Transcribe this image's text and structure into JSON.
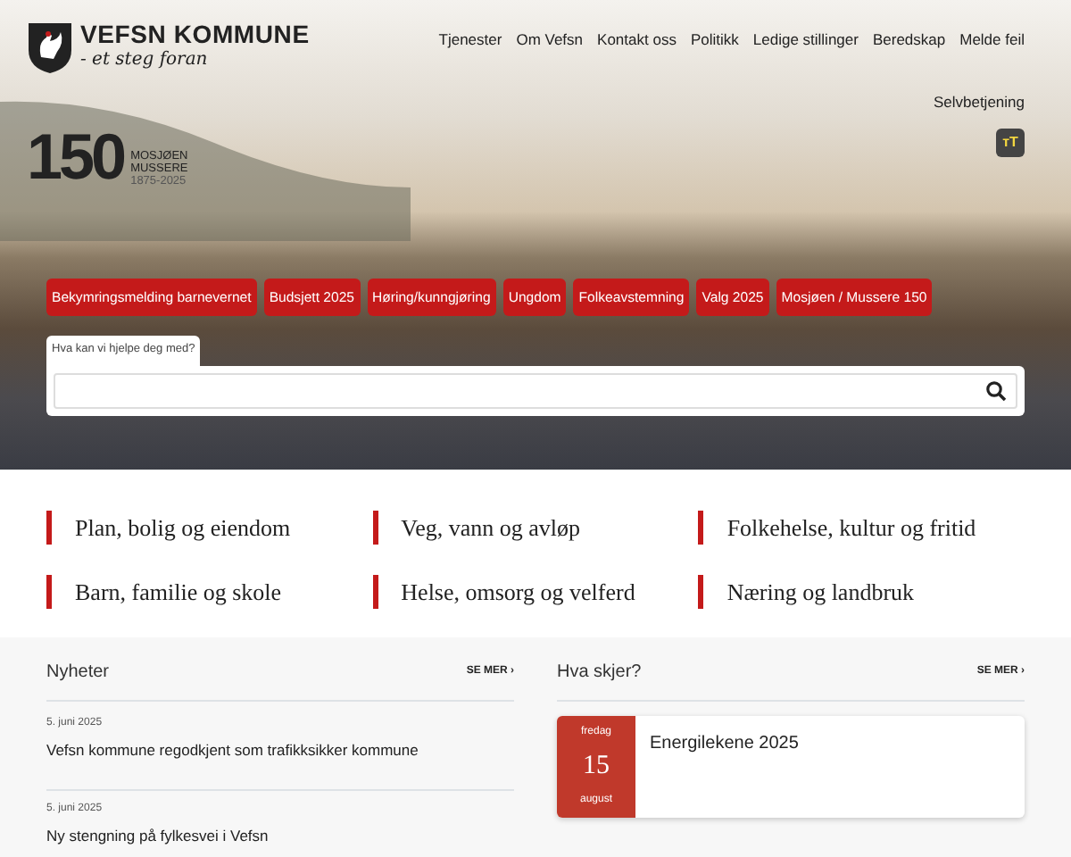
{
  "header": {
    "logo_title": "VEFSN KOMMUNE",
    "logo_tagline": "- et steg foran",
    "nav": [
      "Tjenester",
      "Om Vefsn",
      "Kontakt oss",
      "Politikk",
      "Ledige stillinger",
      "Beredskap",
      "Melde feil"
    ],
    "self_service": "Selvbetjening",
    "text_size_button": "ᴛT"
  },
  "anniversary": {
    "number": "150",
    "line_1": "MOSJØEN",
    "line_2": "MUSSERE",
    "years": "1875-2025"
  },
  "quick_links": [
    "Bekymringsmelding barnevernet",
    "Budsjett 2025",
    "Høring/kunngjøring",
    "Ungdom",
    "Folkeavstemning",
    "Valg 2025",
    "Mosjøen / Mussere 150"
  ],
  "search": {
    "label": "Hva kan vi hjelpe deg med?"
  },
  "categories": [
    "Plan, bolig og eiendom",
    "Veg, vann og avløp",
    "Folkehelse, kultur og fritid",
    "Barn, familie og skole",
    "Helse, omsorg og velferd",
    "Næring og landbruk"
  ],
  "news": {
    "title": "Nyheter",
    "more": "SE MER ›",
    "items": [
      {
        "date": "5. juni 2025",
        "title": "Vefsn kommune regodkjent som trafikksikker kommune"
      },
      {
        "date": "5. juni 2025",
        "title": "Ny stengning på fylkesvei i Vefsn"
      }
    ]
  },
  "events": {
    "title": "Hva skjer?",
    "more": "SE MER ›",
    "items": [
      {
        "weekday": "fredag",
        "day": "15",
        "month": "august",
        "title": "Energilekene 2025"
      }
    ]
  }
}
